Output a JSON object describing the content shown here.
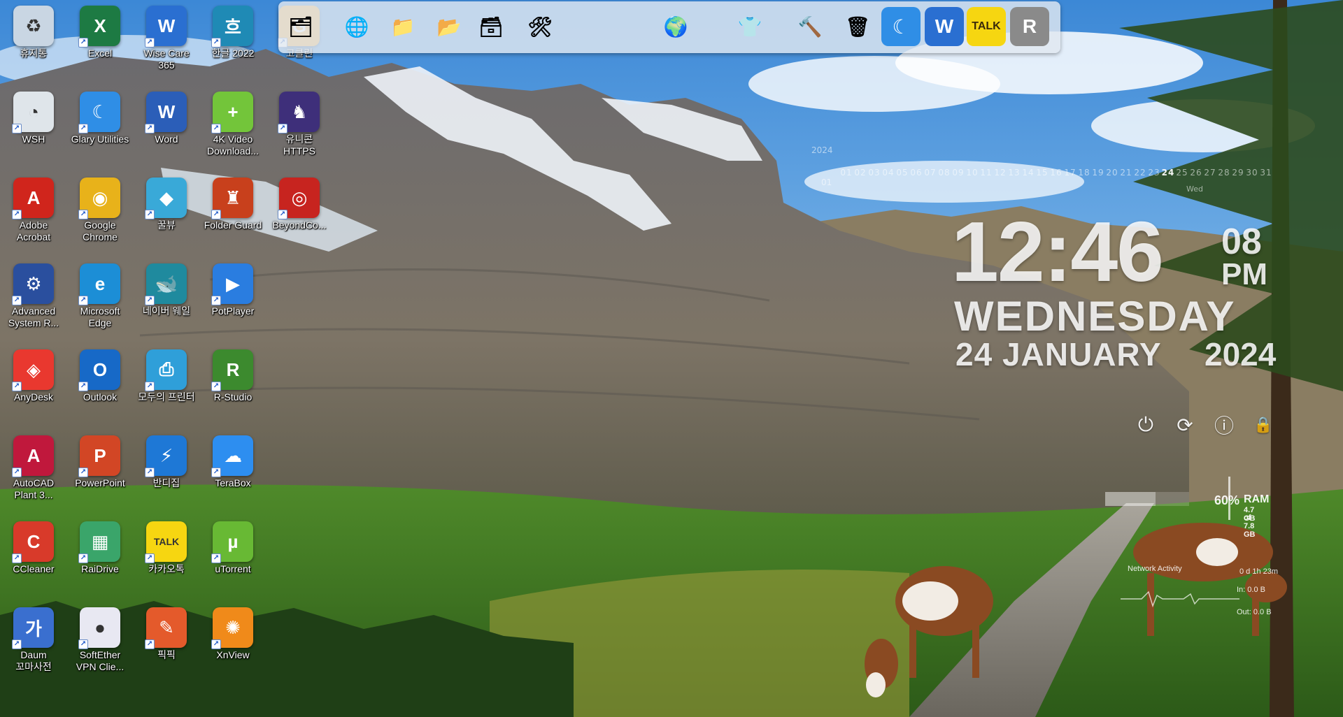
{
  "desktop": {
    "icons": [
      {
        "label": "휴지통",
        "icon": "recycle-bin-icon",
        "color": "#c9d6e3",
        "glyph": "♻"
      },
      {
        "label": "Excel",
        "icon": "excel-icon",
        "color": "#1d7a43",
        "glyph": "X"
      },
      {
        "label": "Wise Care 365",
        "icon": "wise-care-icon",
        "color": "#2a6fd1",
        "glyph": "W"
      },
      {
        "label": "한글 2022",
        "icon": "hangul-icon",
        "color": "#1f8ab5",
        "glyph": "흐"
      },
      {
        "label": "고클린",
        "icon": "goclean-icon",
        "color": "#f0a830",
        "glyph": "G"
      },
      {
        "label": "WSH",
        "icon": "wsh-icon",
        "color": "#dfe5ea",
        "glyph": "◔"
      },
      {
        "label": "Glary Utilities",
        "icon": "glary-utilities-icon",
        "color": "#2f8ee6",
        "glyph": "☾"
      },
      {
        "label": "Word",
        "icon": "word-icon",
        "color": "#2b5eb8",
        "glyph": "W"
      },
      {
        "label": "4K Video Download...",
        "icon": "4k-video-downloader-icon",
        "color": "#73c53a",
        "glyph": "+"
      },
      {
        "label": "유니콘 HTTPS",
        "icon": "unicorn-https-icon",
        "color": "#3e2f7a",
        "glyph": "♞"
      },
      {
        "label": "Adobe Acrobat",
        "icon": "adobe-acrobat-icon",
        "color": "#d0251c",
        "glyph": "A"
      },
      {
        "label": "Google Chrome",
        "icon": "chrome-icon",
        "color": "#e8b21a",
        "glyph": "◉"
      },
      {
        "label": "꿀뷰",
        "icon": "honeyview-icon",
        "color": "#39a9d8",
        "glyph": "◆"
      },
      {
        "label": "Folder Guard",
        "icon": "folder-guard-icon",
        "color": "#c8401c",
        "glyph": "♜"
      },
      {
        "label": "BeyondCo...",
        "icon": "beyond-compare-icon",
        "color": "#c7241f",
        "glyph": "◎"
      },
      {
        "label": "Advanced System R...",
        "icon": "advanced-system-repair-icon",
        "color": "#2a4f9e",
        "glyph": "⚙"
      },
      {
        "label": "Microsoft Edge",
        "icon": "edge-icon",
        "color": "#1c8ed6",
        "glyph": "e"
      },
      {
        "label": "네이버 웨일",
        "icon": "naver-whale-icon",
        "color": "#1f8a9e",
        "glyph": "🐋"
      },
      {
        "label": "PotPlayer",
        "icon": "potplayer-icon",
        "color": "#2a7de0",
        "glyph": "▶"
      },
      {
        "label": "AnyDesk",
        "icon": "anydesk-icon",
        "color": "#e9382f",
        "glyph": "◈"
      },
      {
        "label": "Outlook",
        "icon": "outlook-icon",
        "color": "#1769c7",
        "glyph": "O"
      },
      {
        "label": "모두의 프린터",
        "icon": "modu-printer-icon",
        "color": "#2f9fd9",
        "glyph": "⎙"
      },
      {
        "label": "R-Studio",
        "icon": "r-studio-icon",
        "color": "#3c8a2e",
        "glyph": "R"
      },
      {
        "label": "AutoCAD Plant 3...",
        "icon": "autocad-plant-icon",
        "color": "#c0183c",
        "glyph": "A"
      },
      {
        "label": "PowerPoint",
        "icon": "powerpoint-icon",
        "color": "#d24625",
        "glyph": "P"
      },
      {
        "label": "반디집",
        "icon": "bandizip-icon",
        "color": "#1e78d6",
        "glyph": "⚡"
      },
      {
        "label": "TeraBox",
        "icon": "terabox-icon",
        "color": "#2d8ef0",
        "glyph": "☁"
      },
      {
        "label": "CCleaner",
        "icon": "ccleaner-icon",
        "color": "#d83a2a",
        "glyph": "C"
      },
      {
        "label": "RaiDrive",
        "icon": "raidrive-icon",
        "color": "#3aa56a",
        "glyph": "▦"
      },
      {
        "label": "카카오톡",
        "icon": "kakaotalk-icon",
        "color": "#f6d611",
        "glyph": "TALK"
      },
      {
        "label": "uTorrent",
        "icon": "utorrent-icon",
        "color": "#68b934",
        "glyph": "µ"
      },
      {
        "label": "Daum 꼬마사전",
        "icon": "daum-dictionary-icon",
        "color": "#3a6fcf",
        "glyph": "가"
      },
      {
        "label": "SoftEther VPN Clie...",
        "icon": "softether-vpn-icon",
        "color": "#e8e8f2",
        "glyph": "●"
      },
      {
        "label": "픽픽",
        "icon": "picpick-icon",
        "color": "#e45a2b",
        "glyph": "✎"
      },
      {
        "label": "XnView",
        "icon": "xnview-icon",
        "color": "#f08a1a",
        "glyph": "✺"
      }
    ]
  },
  "dock": {
    "items": [
      {
        "name": "dock-goclean",
        "icon": "goclean-icon",
        "glyph": "🗂",
        "color": "#eaeaea"
      },
      {
        "name": "dock-network-globe",
        "icon": "network-globe-icon",
        "glyph": "🌐",
        "color": "#eaeaea"
      },
      {
        "name": "dock-folder-1",
        "icon": "folder-icon",
        "glyph": "📁",
        "color": "#eaeaea"
      },
      {
        "name": "dock-folder-2",
        "icon": "folder-icon",
        "glyph": "📂",
        "color": "#eaeaea"
      },
      {
        "name": "dock-folder-3",
        "icon": "folder-icon",
        "glyph": "🗃",
        "color": "#eaeaea"
      },
      {
        "name": "dock-tools",
        "icon": "tools-icon",
        "glyph": "🛠",
        "color": "#eaeaea"
      },
      {
        "name": "dock-globe-pen",
        "icon": "globe-icon",
        "glyph": "🌍",
        "color": "#eaeaea"
      },
      {
        "name": "dock-tshirt",
        "icon": "tshirt-icon",
        "glyph": "👕",
        "color": "#eaeaea"
      },
      {
        "name": "dock-hammer",
        "icon": "hammer-icon",
        "glyph": "🔨",
        "color": "#eaeaea"
      },
      {
        "name": "dock-recycle",
        "icon": "recycle-bin-icon",
        "glyph": "🗑",
        "color": "#eaeaea"
      },
      {
        "name": "dock-glary",
        "icon": "glary-utilities-icon",
        "glyph": "☾",
        "color": "#2f8ee6"
      },
      {
        "name": "dock-wise-care",
        "icon": "wise-care-icon",
        "glyph": "W",
        "color": "#2a6fd1"
      },
      {
        "name": "dock-kakaotalk",
        "icon": "kakaotalk-icon",
        "glyph": "TALK",
        "color": "#f6d611"
      },
      {
        "name": "dock-r-studio",
        "icon": "r-studio-icon",
        "glyph": "R",
        "color": "#8a8a8a"
      }
    ]
  },
  "calendar": {
    "year": "2024",
    "month": "01",
    "days": [
      "01",
      "02",
      "03",
      "04",
      "05",
      "06",
      "07",
      "08",
      "09",
      "10",
      "11",
      "12",
      "13",
      "14",
      "15",
      "16",
      "17",
      "18",
      "19",
      "20",
      "21",
      "22",
      "23",
      "24",
      "25",
      "26",
      "27",
      "28",
      "29",
      "30",
      "31"
    ],
    "today": "24",
    "weekday": "Wed"
  },
  "clock": {
    "time": "12:46",
    "seconds": "08",
    "ampm": "PM",
    "day": "WEDNESDAY",
    "date": "24 JANUARY",
    "year": "2024"
  },
  "power": {
    "buttons": [
      {
        "name": "shutdown",
        "icon": "power-icon",
        "glyph": "⏻"
      },
      {
        "name": "restart",
        "icon": "restart-icon",
        "glyph": "⟳"
      },
      {
        "name": "logoff",
        "icon": "logoff-icon",
        "glyph": "ⓘ"
      },
      {
        "name": "lock",
        "icon": "lock-icon",
        "glyph": "🔒"
      }
    ]
  },
  "ram": {
    "percent": 60,
    "percent_label": "60%",
    "label": "RAM",
    "used": "4.7 GB",
    "total": "of 7.8 GB"
  },
  "network": {
    "title": "Network Activity",
    "uptime": "0 d 1h 23m",
    "in": "In: 0.0 B",
    "out": "Out: 0.0 B"
  }
}
